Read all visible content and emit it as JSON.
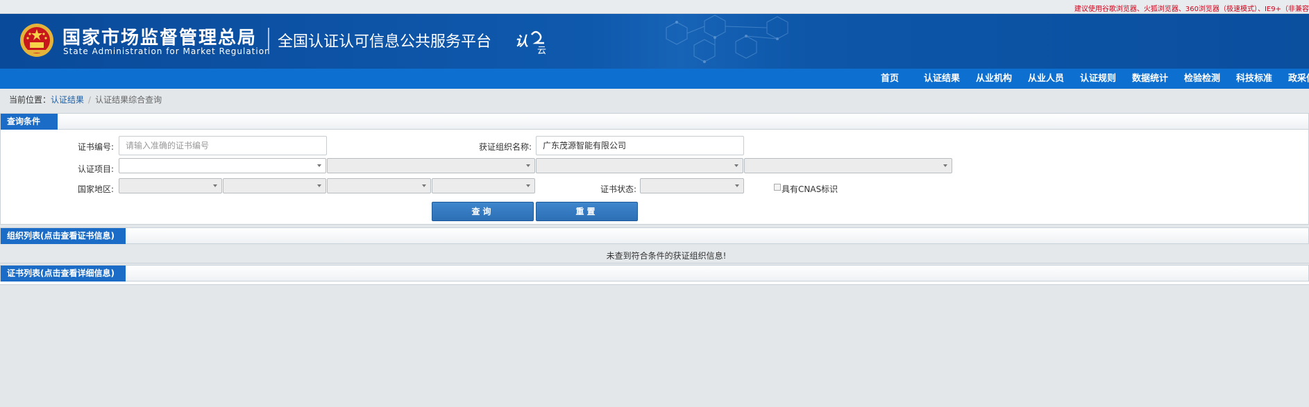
{
  "topbar": {
    "notice": "建议使用谷歌浏览器、火狐浏览器、360浏览器（极速模式）、IE9+（非兼容"
  },
  "header": {
    "org_cn": "国家市场监督管理总局",
    "org_en": "State Administration  for  Market Regulation",
    "platform": "全国认证认可信息公共服务平台",
    "logo_text": "认云"
  },
  "nav": {
    "items": [
      {
        "label": "首页"
      },
      {
        "label": "认证结果"
      },
      {
        "label": "从业机构"
      },
      {
        "label": "从业人员"
      },
      {
        "label": "认证规则"
      },
      {
        "label": "数据统计"
      },
      {
        "label": "检验检测"
      },
      {
        "label": "科技标准"
      },
      {
        "label": "政采信"
      }
    ]
  },
  "breadcrumb": {
    "prefix": "当前位置：",
    "link": "认证结果",
    "sep": "/",
    "current": "认证结果综合查询"
  },
  "query": {
    "title": "查询条件",
    "cert_no_label": "证书编号:",
    "cert_no_placeholder": "请输入准确的证书编号",
    "org_name_label": "获证组织名称:",
    "org_name_value": "广东茂源智能有限公司",
    "project_label": "认证项目:",
    "region_label": "国家地区:",
    "status_label": "证书状态:",
    "cnas_label": "具有CNAS标识",
    "search_button": "查询",
    "reset_button": "重置"
  },
  "org_list": {
    "title": "组织列表(点击查看证书信息)",
    "empty_message": "未查到符合条件的获证组织信息!"
  },
  "cert_list": {
    "title": "证书列表(点击查看详细信息)"
  },
  "colors": {
    "header_blue": "#0b4f9f",
    "nav_blue": "#0d6fd0",
    "tab_blue": "#1b6cc7",
    "button_blue": "#2c6fb5",
    "notice_red": "#d0021b"
  }
}
